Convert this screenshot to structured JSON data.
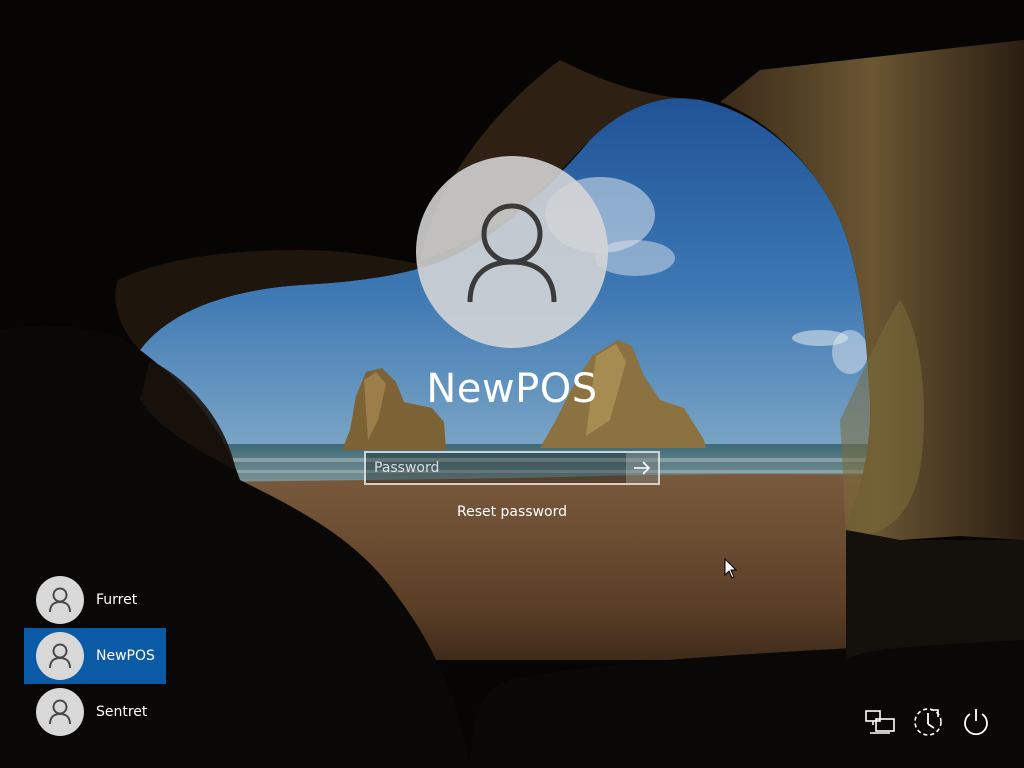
{
  "login": {
    "username": "NewPOS",
    "password_placeholder": "Password",
    "password_value": "",
    "reset_password_label": "Reset password",
    "submit_icon": "arrow-right-icon",
    "avatar_icon": "user-icon"
  },
  "user_list": [
    {
      "name": "Furret",
      "selected": false
    },
    {
      "name": "NewPOS",
      "selected": true
    },
    {
      "name": "Sentret",
      "selected": false
    }
  ],
  "system_tray": {
    "network_icon": "network-icon",
    "ease_of_access_icon": "ease-of-access-icon",
    "power_icon": "power-icon"
  },
  "colors": {
    "selected_user": "#0b5aa6",
    "avatar_bg": "#d8d8d8",
    "text": "#ffffff"
  }
}
